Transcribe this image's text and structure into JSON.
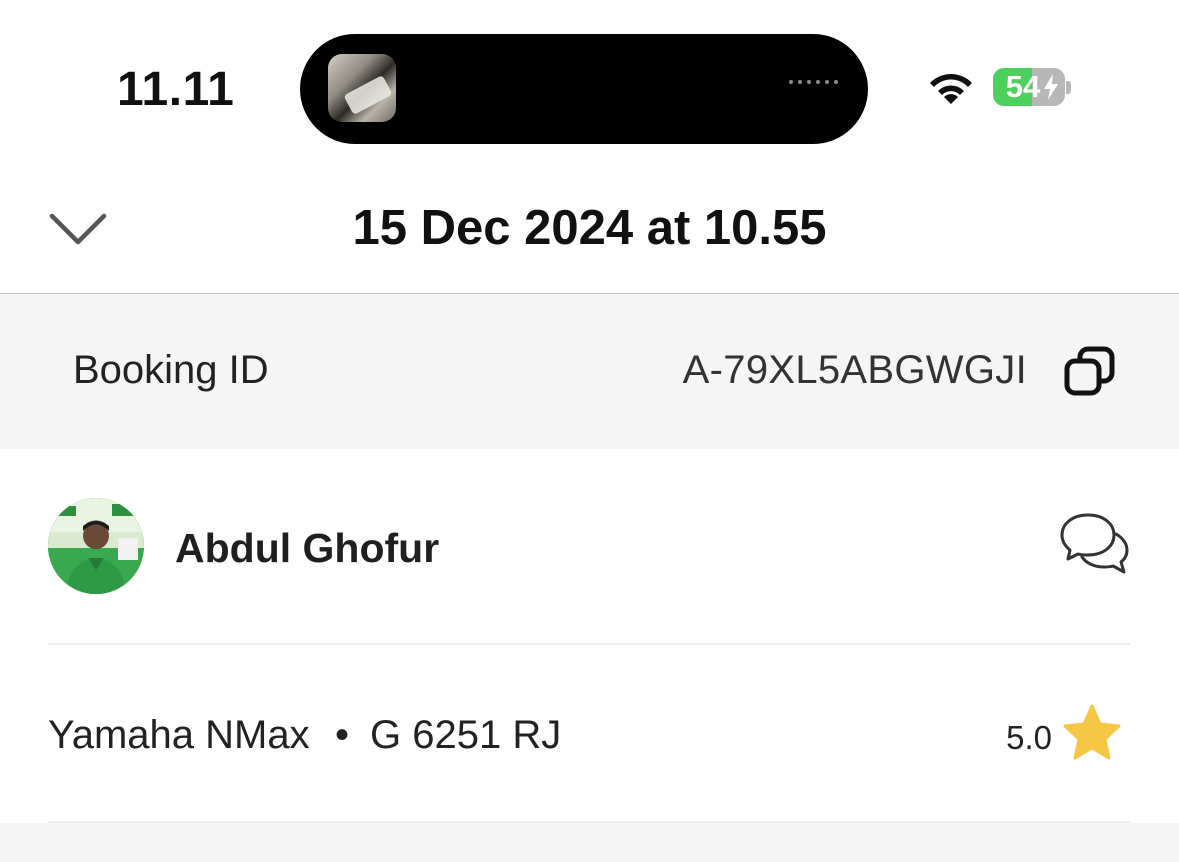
{
  "status_bar": {
    "time": "11.11",
    "battery_level": "54",
    "battery_fraction": 0.54,
    "charging": true,
    "icons": [
      "wifi-icon",
      "battery-icon",
      "charging-bolt-icon"
    ]
  },
  "header": {
    "title": "15 Dec 2024 at 10.55",
    "collapse_icon": "chevron-down-icon"
  },
  "booking": {
    "label": "Booking ID",
    "value": "A-79XL5ABGWGJI",
    "copy_icon": "copy-icon"
  },
  "driver": {
    "name": "Abdul Ghofur",
    "chat_icon": "chat-bubbles-icon",
    "avatar_icon": "driver-avatar"
  },
  "vehicle": {
    "model": "Yamaha NMax",
    "separator": "•",
    "plate": "G 6251 RJ",
    "rating": "5.0",
    "rating_icon": "star-icon"
  },
  "colors": {
    "battery_green": "#4cd15c",
    "star_yellow": "#f6c744",
    "section_bg": "#f5f5f5",
    "avatar_green": "#3daa52"
  }
}
